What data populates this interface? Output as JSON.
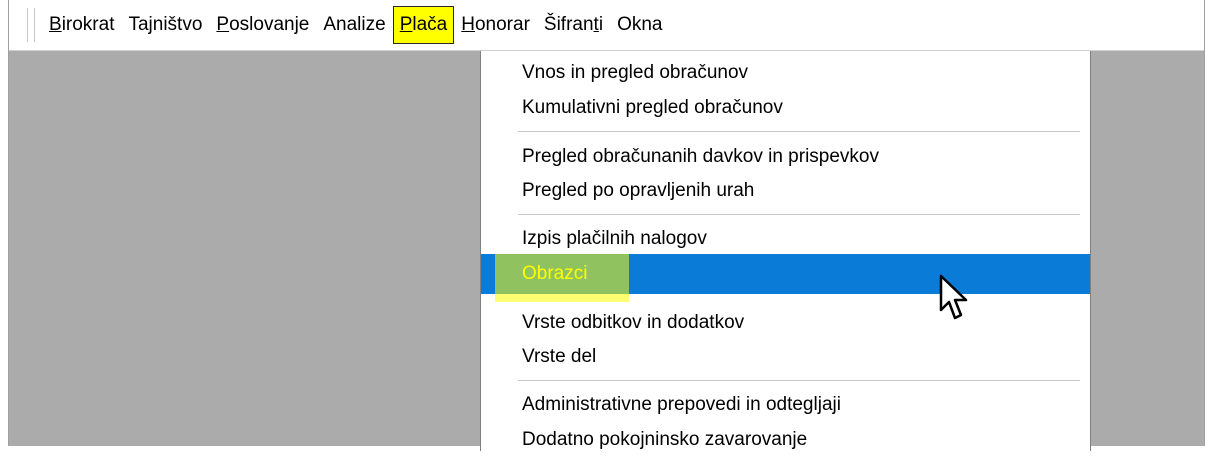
{
  "menubar": {
    "items": [
      {
        "mnemonic": "B",
        "rest": "irokrat"
      },
      {
        "mnemonic": "",
        "rest": "Tajništvo"
      },
      {
        "mnemonic": "P",
        "rest": "oslovanje"
      },
      {
        "mnemonic": "",
        "rest": "Analize"
      },
      {
        "mnemonic": "P",
        "rest": "lača"
      },
      {
        "mnemonic": "H",
        "rest": "onorar"
      },
      {
        "pre": "Šifran",
        "mnemonic": "t",
        "rest": "i"
      },
      {
        "mnemonic": "",
        "rest": "Okna"
      }
    ],
    "active_index": 4
  },
  "dropdown": {
    "items": [
      "Vnos in pregled obračunov",
      "Kumulativni pregled obračunov",
      "Pregled obračunanih davkov in prispevkov",
      "Pregled po opravljenih urah",
      "Izpis plačilnih nalogov",
      "Obrazci",
      "Vrste odbitkov in dodatkov",
      "Vrste del",
      "Administrativne prepovedi in odtegljaji",
      "Dodatno pokojninsko zavarovanje"
    ],
    "selected_index": 5
  },
  "colors": {
    "selection": "#0a7bd6",
    "highlight": "#ffff00",
    "mdi_background": "#ababab"
  }
}
